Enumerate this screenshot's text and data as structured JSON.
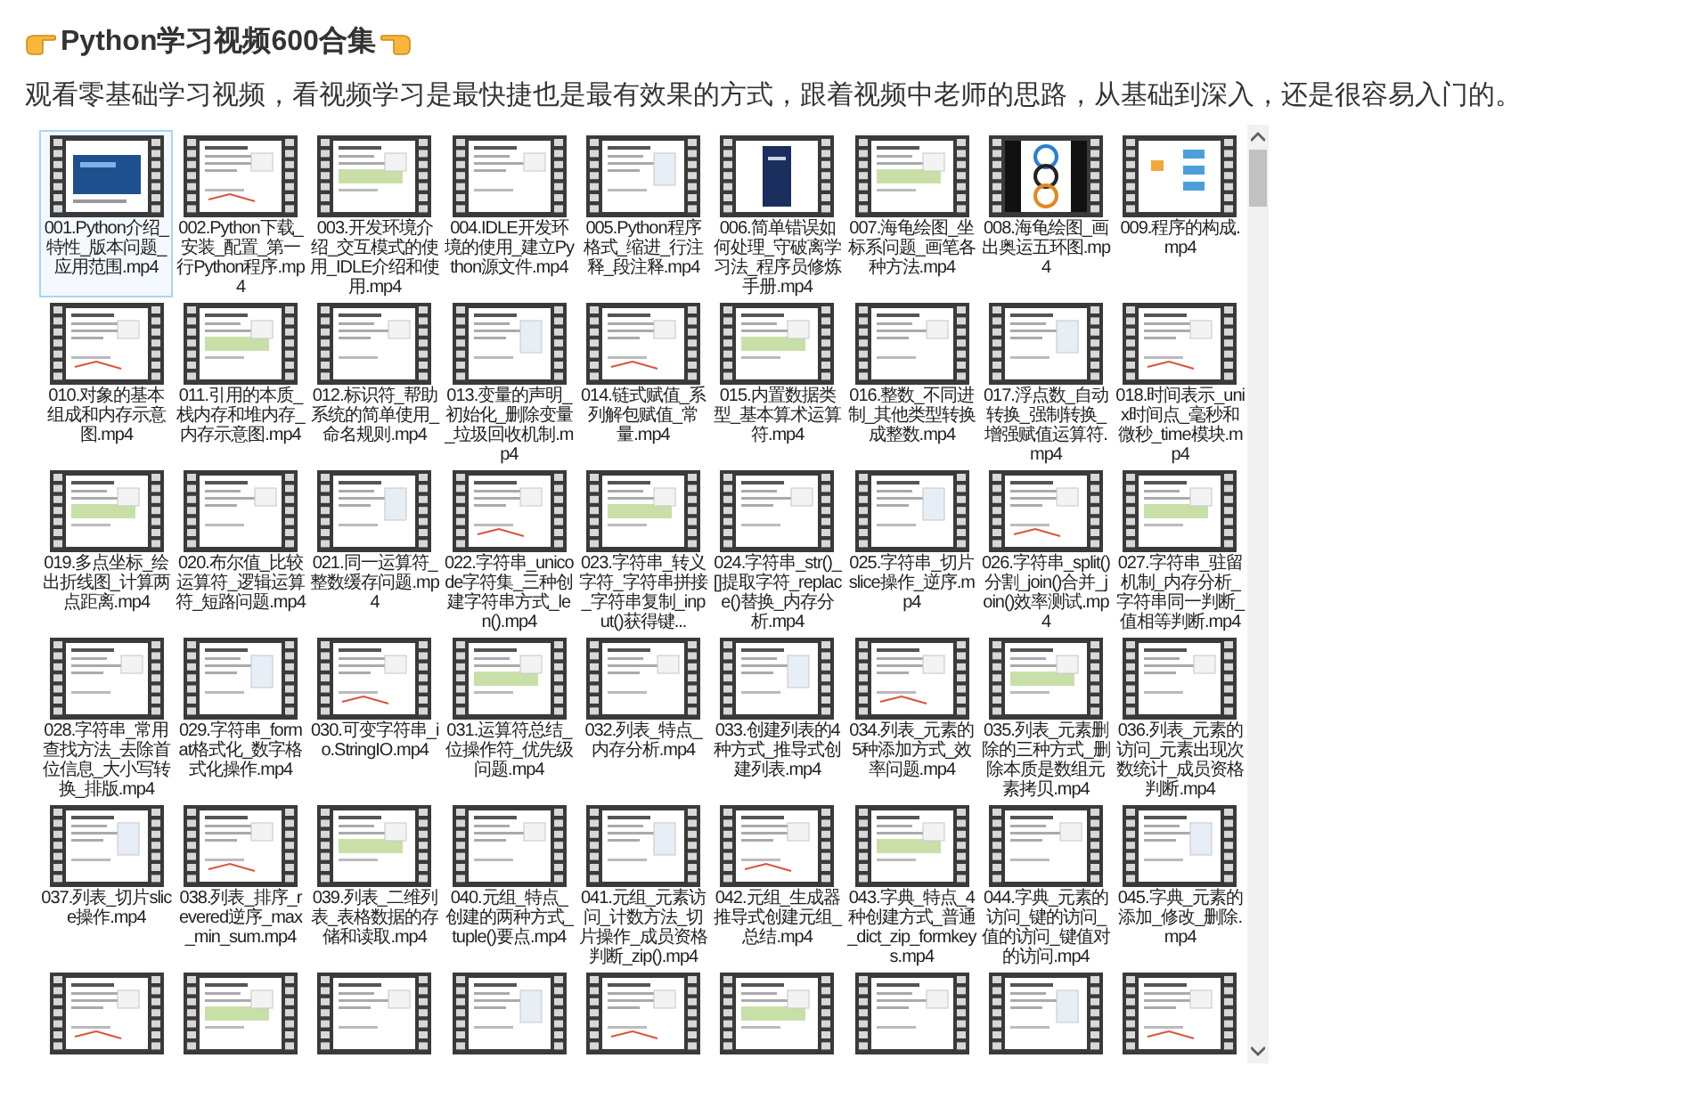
{
  "title": "Python学习视频600合集",
  "intro": "观看零基础学习视频，看视频学习是最快捷也是最有效果的方式，跟着视频中老师的思路，从基础到深入，还是很容易入门的。",
  "files": [
    {
      "label": "001.Python介绍_特性_版本问题_应用范围.mp4",
      "selected": true
    },
    {
      "label": "002.Python下载_安装_配置_第一行Python程序.mp4",
      "selected": false
    },
    {
      "label": "003.开发环境介绍_交互模式的使用_IDLE介绍和使用.mp4",
      "selected": false
    },
    {
      "label": "004.IDLE开发环境的使用_建立Python源文件.mp4",
      "selected": false
    },
    {
      "label": "005.Python程序格式_缩进_行注释_段注释.mp4",
      "selected": false
    },
    {
      "label": "006.简单错误如何处理_守破离学习法_程序员修炼手册.mp4",
      "selected": false
    },
    {
      "label": "007.海龟绘图_坐标系问题_画笔各种方法.mp4",
      "selected": false
    },
    {
      "label": "008.海龟绘图_画出奥运五环图.mp4",
      "selected": false
    },
    {
      "label": "009.程序的构成.mp4",
      "selected": false
    },
    {
      "label": "010.对象的基本组成和内存示意图.mp4",
      "selected": false
    },
    {
      "label": "011.引用的本质_栈内存和堆内存_内存示意图.mp4",
      "selected": false
    },
    {
      "label": "012.标识符_帮助系统的简单使用_命名规则.mp4",
      "selected": false
    },
    {
      "label": "013.变量的声明_初始化_删除变量_垃圾回收机制.mp4",
      "selected": false
    },
    {
      "label": "014.链式赋值_系列解包赋值_常量.mp4",
      "selected": false
    },
    {
      "label": "015.内置数据类型_基本算术运算符.mp4",
      "selected": false
    },
    {
      "label": "016.整数_不同进制_其他类型转换成整数.mp4",
      "selected": false
    },
    {
      "label": "017.浮点数_自动转换_强制转换_增强赋值运算符.mp4",
      "selected": false
    },
    {
      "label": "018.时间表示_unix时间点_毫秒和微秒_time模块.mp4",
      "selected": false
    },
    {
      "label": "019.多点坐标_绘出折线图_计算两点距离.mp4",
      "selected": false
    },
    {
      "label": "020.布尔值_比较运算符_逻辑运算符_短路问题.mp4",
      "selected": false
    },
    {
      "label": "021.同一运算符_整数缓存问题.mp4",
      "selected": false
    },
    {
      "label": "022.字符串_unicode字符集_三种创建字符串方式_len().mp4",
      "selected": false
    },
    {
      "label": "023.字符串_转义字符_字符串拼接_字符串复制_input()获得键...",
      "selected": false
    },
    {
      "label": "024.字符串_str()_[]提取字符_replace()替换_内存分析.mp4",
      "selected": false
    },
    {
      "label": "025.字符串_切片slice操作_逆序.mp4",
      "selected": false
    },
    {
      "label": "026.字符串_split()分割_join()合并_join()效率测试.mp4",
      "selected": false
    },
    {
      "label": "027.字符串_驻留机制_内存分析_字符串同一判断_值相等判断.mp4",
      "selected": false
    },
    {
      "label": "028.字符串_常用查找方法_去除首位信息_大小写转换_排版.mp4",
      "selected": false
    },
    {
      "label": "029.字符串_format格式化_数字格式化操作.mp4",
      "selected": false
    },
    {
      "label": "030.可变字符串_io.StringIO.mp4",
      "selected": false
    },
    {
      "label": "031.运算符总结_位操作符_优先级问题.mp4",
      "selected": false
    },
    {
      "label": "032.列表_特点_内存分析.mp4",
      "selected": false
    },
    {
      "label": "033.创建列表的4种方式_推导式创建列表.mp4",
      "selected": false
    },
    {
      "label": "034.列表_元素的5种添加方式_效率问题.mp4",
      "selected": false
    },
    {
      "label": "035.列表_元素删除的三种方式_删除本质是数组元素拷贝.mp4",
      "selected": false
    },
    {
      "label": "036.列表_元素的访问_元素出现次数统计_成员资格判断.mp4",
      "selected": false
    },
    {
      "label": "037.列表_切片slice操作.mp4",
      "selected": false
    },
    {
      "label": "038.列表_排序_revered逆序_max_min_sum.mp4",
      "selected": false
    },
    {
      "label": "039.列表_二维列表_表格数据的存储和读取.mp4",
      "selected": false
    },
    {
      "label": "040.元组_特点_创建的两种方式_tuple()要点.mp4",
      "selected": false
    },
    {
      "label": "041.元组_元素访问_计数方法_切片操作_成员资格判断_zip().mp4",
      "selected": false
    },
    {
      "label": "042.元组_生成器推导式创建元组_总结.mp4",
      "selected": false
    },
    {
      "label": "043.字典_特点_4种创建方式_普通_dict_zip_formkeys.mp4",
      "selected": false
    },
    {
      "label": "044.字典_元素的访问_键的访问_值的访问_键值对的访问.mp4",
      "selected": false
    },
    {
      "label": "045.字典_元素的添加_修改_删除.mp4",
      "selected": false
    },
    {
      "selected": false
    },
    {
      "selected": false
    },
    {
      "selected": false
    },
    {
      "selected": false
    },
    {
      "selected": false
    },
    {
      "selected": false
    },
    {
      "selected": false
    },
    {
      "selected": false
    },
    {
      "selected": false
    }
  ]
}
